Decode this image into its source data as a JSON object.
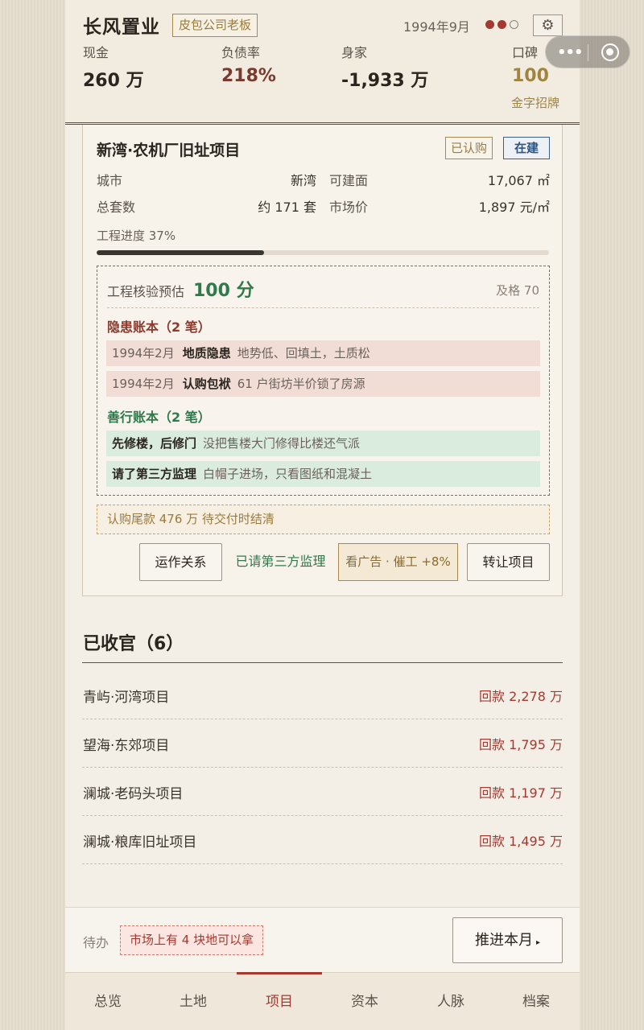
{
  "header": {
    "company": "长风置业",
    "role_badge": "皮包公司老板",
    "date": "1994年9月",
    "gear_icon": "gear-icon",
    "stats": {
      "cash": {
        "label": "现金",
        "value": "260 万"
      },
      "debt_ratio": {
        "label": "负债率",
        "value": "218%"
      },
      "net_worth": {
        "label": "身家",
        "value": "-1,933 万"
      },
      "reputation": {
        "label": "口碑",
        "value": "100",
        "sub": "金字招牌"
      }
    },
    "colors": {
      "debt": "#7a3a2e",
      "reputation": "#a0843f"
    }
  },
  "project": {
    "title": "新湾·农机厂旧址项目",
    "tag_bought": "已认购",
    "tag_status": "在建",
    "info": {
      "city_label": "城市",
      "city_value": "新湾",
      "area_label": "可建面",
      "area_value": "17,067 ㎡",
      "units_label": "总套数",
      "units_value": "约 171 套",
      "price_label": "市场价",
      "price_value": "1,897 元/㎡"
    },
    "progress_label": "工程进度 37%",
    "progress": 0.37,
    "audit": {
      "label": "工程核验预估",
      "score": "100 分",
      "pass": "及格 70",
      "risk_title": "隐患账本（2 笔）",
      "risks": [
        {
          "date": "1994年2月",
          "name": "地质隐患",
          "desc": "地势低、回填土，土质松"
        },
        {
          "date": "1994年2月",
          "name": "认购包袱",
          "desc": "61 户街坊半价锁了房源"
        }
      ],
      "good_title": "善行账本（2 笔）",
      "goods": [
        {
          "name": "先修楼，后修门",
          "desc": "没把售楼大门修得比楼还气派"
        },
        {
          "name": "请了第三方监理",
          "desc": "白帽子进场，只看图纸和混凝土"
        }
      ]
    },
    "payment_note": "认购尾款 476 万 待交付时结清",
    "buttons": {
      "ops": "运作关系",
      "hired": "已请第三方监理",
      "ad": "看广告 · 催工 +8%",
      "transfer": "转让项目"
    }
  },
  "closed": {
    "title": "已收官（6）",
    "items": [
      {
        "name": "青屿·河湾项目",
        "value": "回款 2,278 万"
      },
      {
        "name": "望海·东郊项目",
        "value": "回款 1,795 万"
      },
      {
        "name": "澜城·老码头项目",
        "value": "回款 1,197 万"
      },
      {
        "name": "澜城·粮库旧址项目",
        "value": "回款 1,495 万"
      }
    ]
  },
  "todo": {
    "label": "待办",
    "badge": "市场上有 4 块地可以拿",
    "advance": "推进本月",
    "advance_arrow": "▸"
  },
  "tabs": [
    {
      "label": "总览"
    },
    {
      "label": "土地"
    },
    {
      "label": "项目",
      "active": true
    },
    {
      "label": "资本"
    },
    {
      "label": "人脉"
    },
    {
      "label": "档案"
    }
  ],
  "capsule": {
    "more_icon": "more-dots-icon",
    "close_icon": "target-icon"
  }
}
